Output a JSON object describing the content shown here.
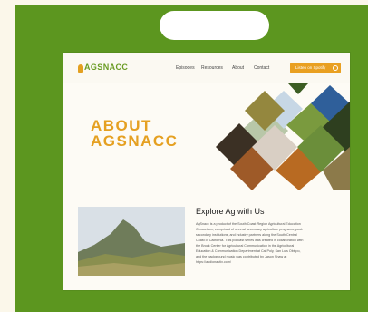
{
  "nav": {
    "logo": "AGSNACC",
    "links": [
      "Episodes",
      "Resources",
      "About",
      "Contact"
    ],
    "cta_label": "Listen on Spotify"
  },
  "hero": {
    "title_line1": "ABOUT",
    "title_line2": "AGSNACC"
  },
  "explore": {
    "heading": "Explore Ag with Us",
    "lines": [
      "AgSnacc is a product of the South Coast Region Agricultural Education",
      "Consortium, comprised of several secondary agriculture programs, post-",
      "secondary institutions, and industry partners along the South Central",
      "Coast of California. This podcast series was created in collaboration with",
      "the Brock Center for Agricultural Communication in the Agricultural",
      "Education & Communication Department at Cal Poly, San Luis Obispo,",
      "and the background music was contributed by Jason Shaw at",
      "https://audionautix.com/"
    ]
  },
  "colors": {
    "frame": "#5c961f",
    "page": "#fbf7ea",
    "accent": "#e5a021",
    "logo_green": "#6a9c23"
  },
  "icons": [
    "headphones-icon"
  ]
}
